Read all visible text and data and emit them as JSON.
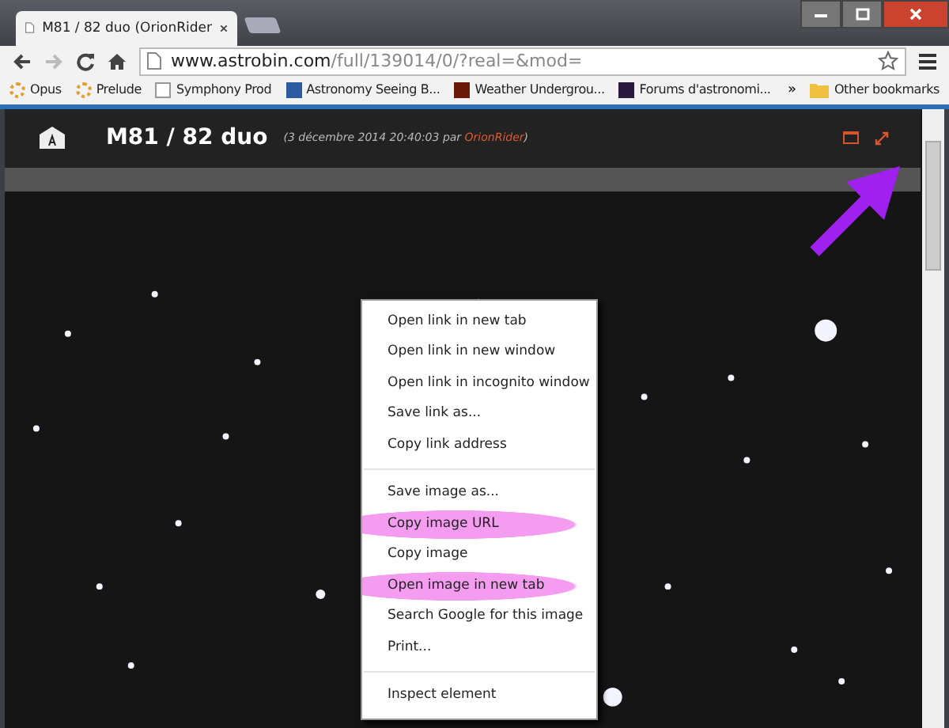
{
  "browser": {
    "tab": {
      "title": "M81 / 82 duo (OrionRider"
    },
    "address": {
      "host": "www.astrobin.com",
      "path": "/full/139014/0/?real=&mod="
    },
    "bookmarks": [
      {
        "label": "Opus"
      },
      {
        "label": "Prelude"
      },
      {
        "label": "Symphony Prod"
      },
      {
        "label": "Astronomy Seeing B..."
      },
      {
        "label": "Weather Undergrou..."
      },
      {
        "label": "Forums d'astronomi..."
      }
    ],
    "more_bookmarks": "»",
    "other_bookmarks": "Other bookmarks"
  },
  "page": {
    "title": "M81 / 82 duo",
    "meta": {
      "prefix": "(3 décembre 2014 20:40:03 par ",
      "author": "OrionRider",
      "suffix": ")"
    }
  },
  "context_menu": {
    "sections": [
      [
        {
          "label": "Open link in new tab",
          "highlighted": false
        },
        {
          "label": "Open link in new window",
          "highlighted": false
        },
        {
          "label": "Open link in incognito window",
          "highlighted": false
        },
        {
          "label": "Save link as...",
          "highlighted": false
        },
        {
          "label": "Copy link address",
          "highlighted": false
        }
      ],
      [
        {
          "label": "Save image as...",
          "highlighted": false
        },
        {
          "label": "Copy image URL",
          "highlighted": true
        },
        {
          "label": "Copy image",
          "highlighted": false
        },
        {
          "label": "Open image in new tab",
          "highlighted": true
        },
        {
          "label": "Search Google for this image",
          "highlighted": false
        },
        {
          "label": "Print...",
          "highlighted": false
        }
      ],
      [
        {
          "label": "Inspect element",
          "highlighted": false
        }
      ]
    ]
  }
}
